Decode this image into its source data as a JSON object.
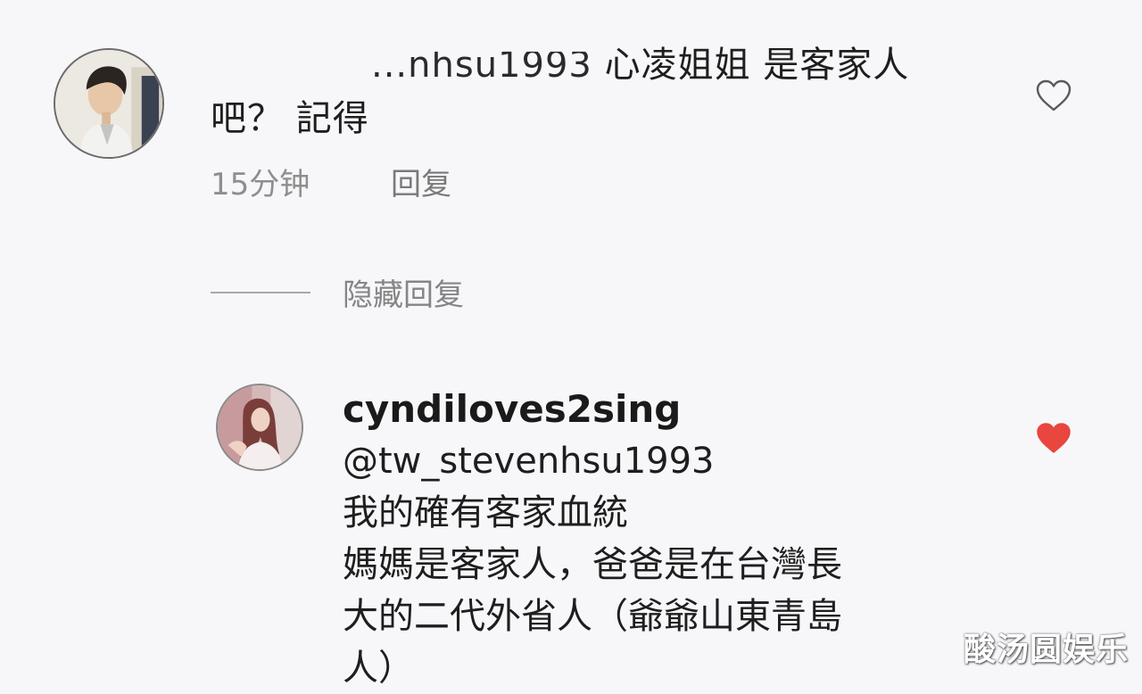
{
  "comments": [
    {
      "username_partial": "...nhsu1993",
      "text_line1": "心凌姐姐 是客家人",
      "text_line2": "吧？ 記得",
      "time": "15分钟",
      "reply_label": "回复",
      "liked": false
    }
  ],
  "hidden_replies_label": "隐藏回复",
  "reply": {
    "username": "cyndiloves2sing",
    "mention": "@tw_stevenhsu1993",
    "lines": [
      "我的確有客家血統",
      "媽媽是客家人，爸爸是在台灣長",
      "大的二代外省人（爺爺山東青島",
      "人）"
    ],
    "liked": true
  },
  "watermark": "酸汤圆娱乐",
  "colors": {
    "background": "#f7f7fa",
    "text": "#1e1e1e",
    "meta_text": "#8e8e8e",
    "like_active": "#e8463e",
    "like_inactive": "#5a5a5a"
  },
  "icons": {
    "like_outline": "heart-outline-icon",
    "like_filled": "heart-filled-icon"
  }
}
